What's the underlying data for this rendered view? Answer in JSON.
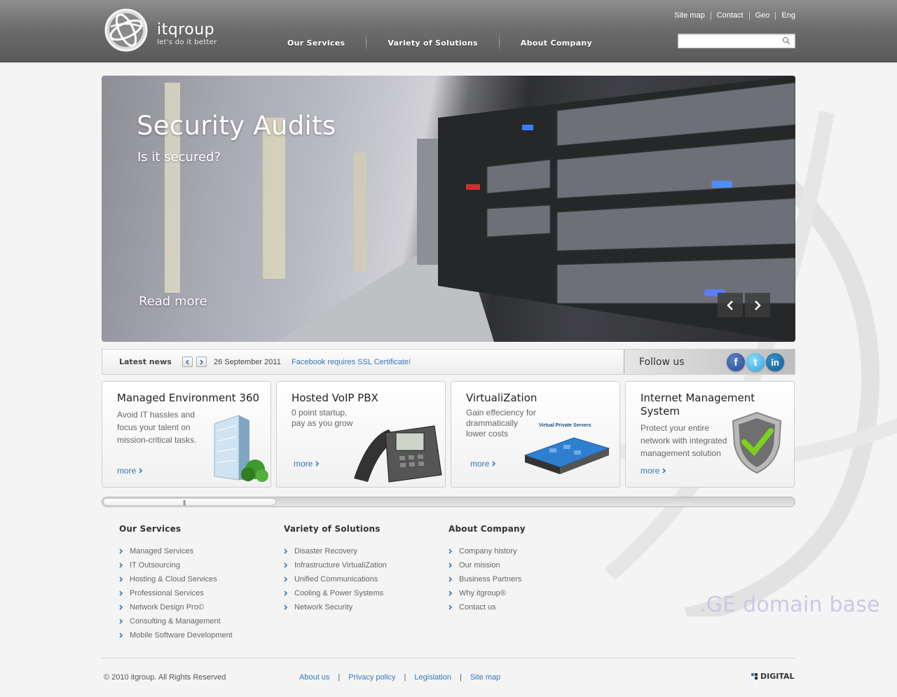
{
  "brand": {
    "name": "itqroup",
    "tagline": "let's do it better"
  },
  "top_links": [
    "Site map",
    "Contact",
    "Geo",
    "Eng"
  ],
  "search": {
    "placeholder": ""
  },
  "nav": [
    "Our Services",
    "Variety of Solutions",
    "About Company"
  ],
  "hero": {
    "title": "Security Audits",
    "subtitle": "Is it secured?",
    "read_more": "Read more"
  },
  "news": {
    "label": "Latest news",
    "date": "26 September 2011",
    "headline": "Facebook requires SSL Certificate!"
  },
  "follow": {
    "label": "Follow us",
    "networks": [
      "f",
      "t",
      "in"
    ]
  },
  "cards": [
    {
      "title": "Managed Environment 360",
      "text": [
        "Avoid IT hassles and",
        "focus your talent on",
        "mission-critical tasks."
      ],
      "more": "more"
    },
    {
      "title": "Hosted VoIP PBX",
      "text": [
        "0 point startup,",
        "pay as you grow"
      ],
      "more": "more"
    },
    {
      "title": "VirtualiZation",
      "text": [
        "Gain effeciency for",
        "drammatically",
        "lower costs"
      ],
      "more": "more",
      "badge": "Virtual Private Servers"
    },
    {
      "title_lines": [
        "Internet Management",
        "System"
      ],
      "text": [
        "Protect your entire",
        "network with integrated",
        "management solution"
      ],
      "more": "more"
    }
  ],
  "footer_columns": [
    {
      "heading": "Our Services",
      "items": [
        "Managed Services",
        "IT Outsourcing",
        "Hosting & Cloud Services",
        "Professional Services",
        "Network Design Pro©",
        "Consulting & Management",
        "Mobile Software Development"
      ]
    },
    {
      "heading": "Variety of Solutions",
      "items": [
        "Disaster Recovery",
        "Infrastructure VirtualiZation",
        "Unified Communications",
        "Cooling & Power Systems",
        "Network Security"
      ]
    },
    {
      "heading": "About Company",
      "items": [
        "Company history",
        "Our mission",
        "Business Partners",
        "Why itgroup®",
        "Contact us"
      ]
    }
  ],
  "domain_base": ".GE domain base",
  "copyright": "© 2010 itgroup. All Rights Reserved",
  "bottom_links": [
    "About us",
    "Privacy policy",
    "Legislation",
    "Site map"
  ],
  "digital_logo": "DIGITAL",
  "colors": {
    "link": "#3478b8",
    "header": "#6d6d6d",
    "chevron": "#3478b8"
  }
}
